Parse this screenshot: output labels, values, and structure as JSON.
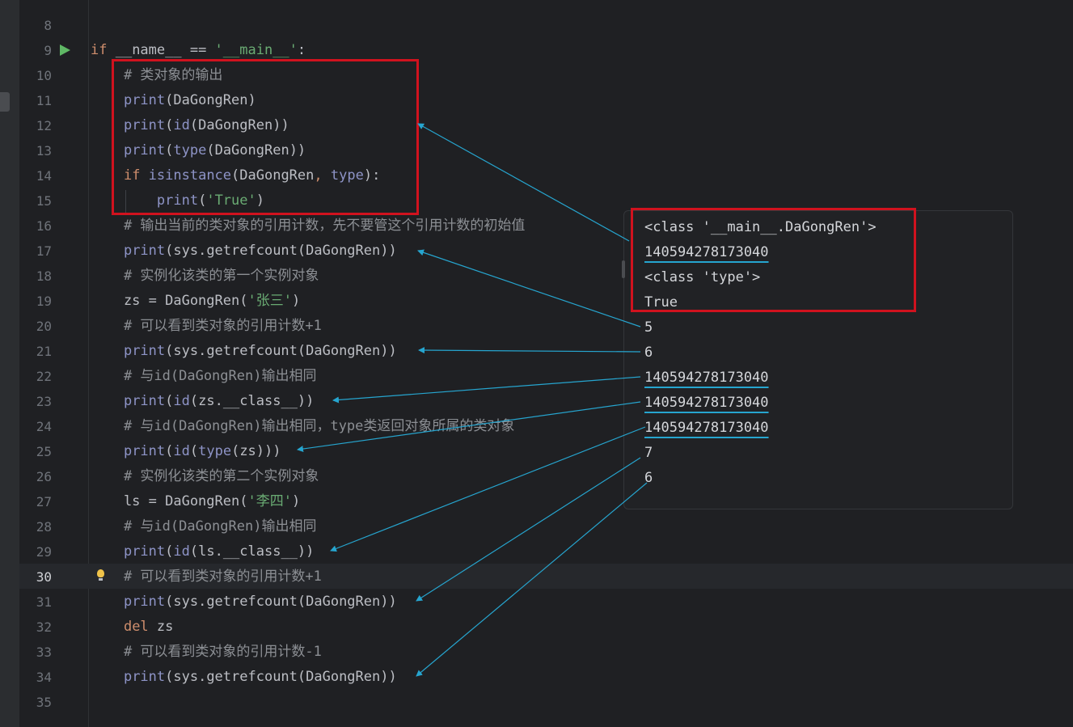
{
  "editor": {
    "lines": [
      {
        "num": "8",
        "segments": []
      },
      {
        "num": "9",
        "segments": [
          {
            "t": "if ",
            "c": "kw"
          },
          {
            "t": "__name__ == ",
            "c": "pl"
          },
          {
            "t": "'__main__'",
            "c": "str"
          },
          {
            "t": ":",
            "c": "pl"
          }
        ]
      },
      {
        "num": "10",
        "segments": [
          {
            "t": "    # 类对象的输出",
            "c": "cm"
          }
        ]
      },
      {
        "num": "11",
        "segments": [
          {
            "t": "    ",
            "c": "pl"
          },
          {
            "t": "print",
            "c": "fn"
          },
          {
            "t": "(DaGongRen)",
            "c": "pl"
          }
        ]
      },
      {
        "num": "12",
        "segments": [
          {
            "t": "    ",
            "c": "pl"
          },
          {
            "t": "print",
            "c": "fn"
          },
          {
            "t": "(",
            "c": "pl"
          },
          {
            "t": "id",
            "c": "fn"
          },
          {
            "t": "(DaGongRen))",
            "c": "pl"
          }
        ]
      },
      {
        "num": "13",
        "segments": [
          {
            "t": "    ",
            "c": "pl"
          },
          {
            "t": "print",
            "c": "fn"
          },
          {
            "t": "(",
            "c": "pl"
          },
          {
            "t": "type",
            "c": "fn"
          },
          {
            "t": "(DaGongRen))",
            "c": "pl"
          }
        ]
      },
      {
        "num": "14",
        "segments": [
          {
            "t": "    ",
            "c": "pl"
          },
          {
            "t": "if ",
            "c": "kw"
          },
          {
            "t": "isinstance",
            "c": "fn"
          },
          {
            "t": "(DaGongRen",
            "c": "pl"
          },
          {
            "t": ", ",
            "c": "kw"
          },
          {
            "t": "type",
            "c": "fn"
          },
          {
            "t": "):",
            "c": "pl"
          }
        ]
      },
      {
        "num": "15",
        "segments": [
          {
            "t": "        ",
            "c": "pl"
          },
          {
            "t": "print",
            "c": "fn"
          },
          {
            "t": "(",
            "c": "pl"
          },
          {
            "t": "'True'",
            "c": "str"
          },
          {
            "t": ")",
            "c": "pl"
          }
        ]
      },
      {
        "num": "16",
        "segments": [
          {
            "t": "    # 输出当前的类对象的引用计数，先不要管这个引用计数的初始值",
            "c": "cm"
          }
        ]
      },
      {
        "num": "17",
        "segments": [
          {
            "t": "    ",
            "c": "pl"
          },
          {
            "t": "print",
            "c": "fn"
          },
          {
            "t": "(sys.getrefcount(DaGongRen))",
            "c": "pl"
          }
        ]
      },
      {
        "num": "18",
        "segments": [
          {
            "t": "    # 实例化该类的第一个实例对象",
            "c": "cm"
          }
        ]
      },
      {
        "num": "19",
        "segments": [
          {
            "t": "    zs = DaGongRen(",
            "c": "pl"
          },
          {
            "t": "'张三'",
            "c": "str"
          },
          {
            "t": ")",
            "c": "pl"
          }
        ]
      },
      {
        "num": "20",
        "segments": [
          {
            "t": "    # 可以看到类对象的引用计数+1",
            "c": "cm"
          }
        ]
      },
      {
        "num": "21",
        "segments": [
          {
            "t": "    ",
            "c": "pl"
          },
          {
            "t": "print",
            "c": "fn"
          },
          {
            "t": "(sys.getrefcount(DaGongRen))",
            "c": "pl"
          }
        ]
      },
      {
        "num": "22",
        "segments": [
          {
            "t": "    # 与id(DaGongRen)输出相同",
            "c": "cm"
          }
        ]
      },
      {
        "num": "23",
        "segments": [
          {
            "t": "    ",
            "c": "pl"
          },
          {
            "t": "print",
            "c": "fn"
          },
          {
            "t": "(",
            "c": "pl"
          },
          {
            "t": "id",
            "c": "fn"
          },
          {
            "t": "(zs.__class__))",
            "c": "pl"
          }
        ]
      },
      {
        "num": "24",
        "segments": [
          {
            "t": "    # 与id(DaGongRen)输出相同，type类返回对象所属的类对象",
            "c": "cm"
          }
        ]
      },
      {
        "num": "25",
        "segments": [
          {
            "t": "    ",
            "c": "pl"
          },
          {
            "t": "print",
            "c": "fn"
          },
          {
            "t": "(",
            "c": "pl"
          },
          {
            "t": "id",
            "c": "fn"
          },
          {
            "t": "(",
            "c": "pl"
          },
          {
            "t": "type",
            "c": "fn"
          },
          {
            "t": "(zs)))",
            "c": "pl"
          }
        ]
      },
      {
        "num": "26",
        "segments": [
          {
            "t": "    # 实例化该类的第二个实例对象",
            "c": "cm"
          }
        ]
      },
      {
        "num": "27",
        "segments": [
          {
            "t": "    ls = DaGongRen(",
            "c": "pl"
          },
          {
            "t": "'李四'",
            "c": "str"
          },
          {
            "t": ")",
            "c": "pl"
          }
        ]
      },
      {
        "num": "28",
        "segments": [
          {
            "t": "    # 与id(DaGongRen)输出相同",
            "c": "cm"
          }
        ]
      },
      {
        "num": "29",
        "segments": [
          {
            "t": "    ",
            "c": "pl"
          },
          {
            "t": "print",
            "c": "fn"
          },
          {
            "t": "(",
            "c": "pl"
          },
          {
            "t": "id",
            "c": "fn"
          },
          {
            "t": "(ls.__class__))",
            "c": "pl"
          }
        ]
      },
      {
        "num": "30",
        "segments": [
          {
            "t": "    # 可以看到类对象的引用计数+1",
            "c": "cm"
          }
        ]
      },
      {
        "num": "31",
        "segments": [
          {
            "t": "    ",
            "c": "pl"
          },
          {
            "t": "print",
            "c": "fn"
          },
          {
            "t": "(sys.getrefcount(DaGongRen))",
            "c": "pl"
          }
        ]
      },
      {
        "num": "32",
        "segments": [
          {
            "t": "    ",
            "c": "pl"
          },
          {
            "t": "del ",
            "c": "kw"
          },
          {
            "t": "zs",
            "c": "pl"
          }
        ]
      },
      {
        "num": "33",
        "segments": [
          {
            "t": "    # 可以看到类对象的引用计数-1",
            "c": "cm"
          }
        ]
      },
      {
        "num": "34",
        "segments": [
          {
            "t": "    ",
            "c": "pl"
          },
          {
            "t": "print",
            "c": "fn"
          },
          {
            "t": "(sys.getrefcount(DaGongRen))",
            "c": "pl"
          }
        ]
      },
      {
        "num": "35",
        "segments": []
      }
    ],
    "current_line": "30"
  },
  "output": {
    "lines": [
      "<class '__main__.DaGongRen'>",
      "140594278173040",
      "<class 'type'>",
      "True",
      "5",
      "6",
      "140594278173040",
      "140594278173040",
      "140594278173040",
      "7",
      "6"
    ],
    "underlined": [
      1,
      6,
      7,
      8
    ]
  },
  "colors": {
    "background": "#1f2023",
    "annotation_box": "#d0121e",
    "arrow": "#26a5cf",
    "keyword": "#cf8e6d",
    "function": "#8e94c7",
    "string": "#6aab73",
    "comment": "#8c8f94"
  },
  "icons": {
    "run": "run-gutter-icon",
    "hint": "lightbulb-icon"
  }
}
